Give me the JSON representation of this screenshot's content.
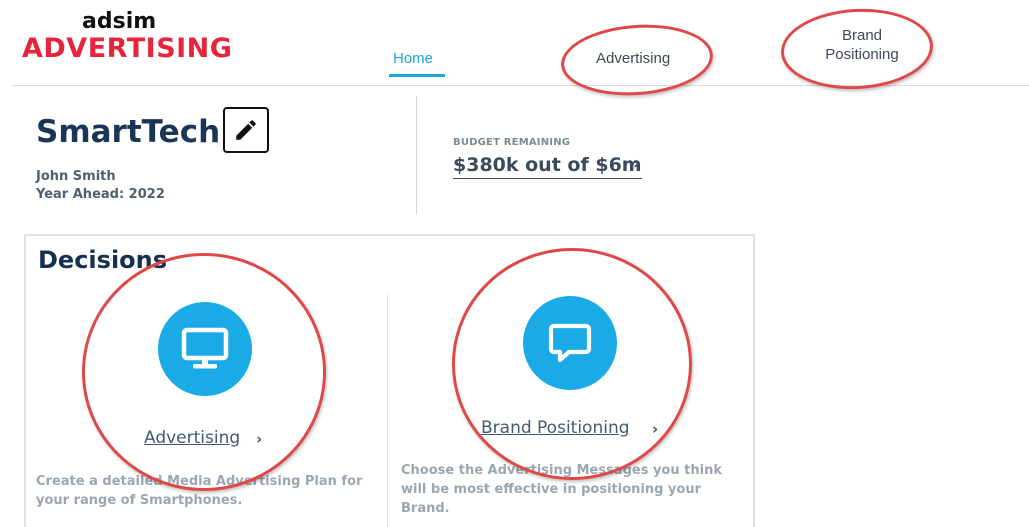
{
  "logo": {
    "top": "adsim",
    "bottom": "ADVERTISING"
  },
  "nav": {
    "home": "Home",
    "advertising": "Advertising",
    "brand_line1": "Brand",
    "brand_line2": "Positioning"
  },
  "company": {
    "name": "SmartTech",
    "user": "John Smith",
    "year": "Year Ahead: 2022"
  },
  "budget": {
    "label": "BUDGET REMAINING",
    "value": "$380k out of $6m",
    "chevron": "›"
  },
  "decisions": {
    "title": "Decisions",
    "cards": [
      {
        "label": "Advertising",
        "chevron": "›",
        "icon": "monitor-icon",
        "desc_line1": "Create a detailed Media Advertising Plan for",
        "desc_line2": "your range of Smartphones."
      },
      {
        "label": "Brand Positioning",
        "chevron": "›",
        "icon": "chat-bubble-icon",
        "desc_line1": "Choose the Advertising Messages you think",
        "desc_line2": "will be most effective in positioning your",
        "desc_line3": "Brand."
      }
    ]
  },
  "colors": {
    "accent": "#1aa6d9",
    "icon_circle": "#1aabe6",
    "brand_red": "#e8243c",
    "annotation": "#e04848",
    "title_navy": "#16304f"
  }
}
